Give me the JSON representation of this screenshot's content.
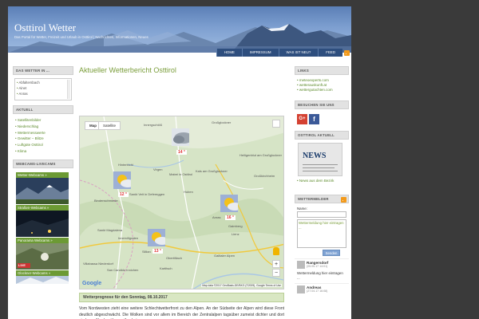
{
  "header": {
    "title": "Osttirol Wetter",
    "subtitle": "Das Portal für Wetter, Freizeit und Urlaub in Osttirol | Nachrichten, Informationen, Neues",
    "nav": [
      "HOME",
      "IMPRESSUM",
      "WAS IST NEU?",
      "FEED"
    ]
  },
  "left": {
    "box1_title": "DAS WETTER IN ...",
    "places": [
      "Abfaltersbach",
      "Ainet",
      "Anras"
    ],
    "aktuell_title": "AKTUELL",
    "aktuell_links": [
      "Satellitenbilder",
      "Niederschlag",
      "Wettermesswerte",
      "Gewitter – Blitze",
      "Luftgüte Osttirol",
      "Klima"
    ],
    "webcams_title": "WEBCAMS-LIVECAMS",
    "webcams": [
      "Wetter-Webcams »",
      "Straßen-Webcams »",
      "Panorama Webcams »",
      "Glockner-Webcams »"
    ],
    "live_badge": "LIVE"
  },
  "main": {
    "title": "Aktueller Wetterbericht Osttirol",
    "map_tabs": [
      "Map",
      "Satellite"
    ],
    "temps": [
      "14 °",
      "12 °",
      "16 °",
      "13 °"
    ],
    "places": [
      "Innergschlöß",
      "Hinterbichl",
      "Virgen",
      "Matrei in Osttirol",
      "Kals am Großglockner",
      "Heiligenblut am Großglockner",
      "Bindenschmiede",
      "Sankt Veit in Defereggen",
      "Huben",
      "Großglockner",
      "Großkirchheim",
      "Anras",
      "Gaimberg",
      "Lienz",
      "Sankt Magdalena",
      "Obertilliach",
      "Kartitsch",
      "Innervillgraten",
      "Villabassa Niederdorf",
      "San Candido Innichen",
      "Sillian",
      "Gailtaler Alpen"
    ],
    "zoom_in": "+",
    "zoom_out": "−",
    "google": "Google",
    "attribution": "Map data ©2017 GeoBasis-DE/BKG (©2009), Google  Terms of Use",
    "forecast_title": "Wetterprognose für den Sonntag, 08.10.2017",
    "forecast_text": "Vom Nordwesten zieht eine weitere Schlechtwetterfront zu den Alpen. An der Südseite der Alpen wird diese Front deutlich abgeschwächt. Die Wolken sind vor allem im Bereich der Zentralalpen tagsüber zumeist dichter und dort sind vom Norden übergreifend ein"
  },
  "right": {
    "links_title": "LINKS",
    "links": [
      "meteoexperts.com",
      "wetterauskunft.at",
      "wettergutachten.com"
    ],
    "social_title": "BESUCHEN SIE UNS",
    "gplus": "G+",
    "fb": "f",
    "osttirol_title": "OSTTIROL AKTUELL",
    "news_word": "NEWS",
    "news_link": "News aus dem Bezirk",
    "melder_title": "WETTERMELDER",
    "name_label": "Name:",
    "textarea_placeholder": "Wettermeldung hier eintragen ...",
    "send": "Senden",
    "entries": [
      {
        "name": "Rangersdorf",
        "date": "(05.05.17 14:01)",
        "msg": "Wettermeldung hier eintragen ..."
      },
      {
        "name": "Andreas",
        "date": "(27.04.17 16:08)",
        "msg": ""
      }
    ]
  },
  "colors": {
    "accent_green": "#7a9d3a",
    "nav_blue": "#2e4e7e",
    "temp_red": "#e03030"
  }
}
